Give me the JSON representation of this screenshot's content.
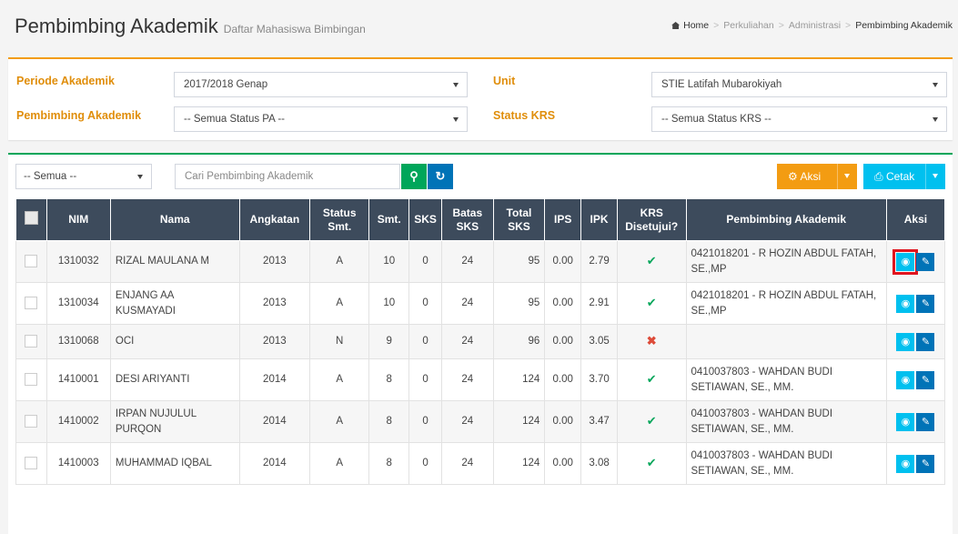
{
  "page": {
    "title": "Pembimbing Akademik",
    "subtitle": "Daftar Mahasiswa Bimbingan"
  },
  "breadcrumb": [
    "Home",
    "Perkuliahan",
    "Administrasi",
    "Pembimbing Akademik"
  ],
  "filters": {
    "periode_label": "Periode Akademik",
    "periode_value": "2017/2018 Genap",
    "unit_label": "Unit",
    "unit_value": "STIE Latifah Mubarokiyah",
    "pa_label": "Pembimbing Akademik",
    "pa_value": "-- Semua Status PA --",
    "krs_label": "Status KRS",
    "krs_value": "-- Semua Status KRS --"
  },
  "toolbar": {
    "filter_value": "-- Semua --",
    "search_placeholder": "Cari Pembimbing Akademik",
    "aksi_label": "Aksi",
    "cetak_label": "Cetak"
  },
  "columns": [
    "NIM",
    "Nama",
    "Angkatan",
    "Status Smt.",
    "Smt.",
    "SKS",
    "Batas SKS",
    "Total SKS",
    "IPS",
    "IPK",
    "KRS Disetujui?",
    "Pembimbing Akademik",
    "Aksi"
  ],
  "rows": [
    {
      "nim": "1310032",
      "nama": "RIZAL MAULANA M",
      "angkatan": "2013",
      "status": "A",
      "smt": "10",
      "sks": "0",
      "batas": "24",
      "total": "95",
      "ips": "0.00",
      "ipk": "2.79",
      "krs": "yes",
      "pa": "0421018201 - R HOZIN ABDUL FATAH, SE.,MP"
    },
    {
      "nim": "1310034",
      "nama": "ENJANG AA KUSMAYADI",
      "angkatan": "2013",
      "status": "A",
      "smt": "10",
      "sks": "0",
      "batas": "24",
      "total": "95",
      "ips": "0.00",
      "ipk": "2.91",
      "krs": "yes",
      "pa": "0421018201 - R HOZIN ABDUL FATAH, SE.,MP"
    },
    {
      "nim": "1310068",
      "nama": "OCI",
      "angkatan": "2013",
      "status": "N",
      "smt": "9",
      "sks": "0",
      "batas": "24",
      "total": "96",
      "ips": "0.00",
      "ipk": "3.05",
      "krs": "no",
      "pa": ""
    },
    {
      "nim": "1410001",
      "nama": "DESI ARIYANTI",
      "angkatan": "2014",
      "status": "A",
      "smt": "8",
      "sks": "0",
      "batas": "24",
      "total": "124",
      "ips": "0.00",
      "ipk": "3.70",
      "krs": "yes",
      "pa": "0410037803 - WAHDAN BUDI SETIAWAN, SE., MM."
    },
    {
      "nim": "1410002",
      "nama": "IRPAN NUJULUL PURQON",
      "angkatan": "2014",
      "status": "A",
      "smt": "8",
      "sks": "0",
      "batas": "24",
      "total": "124",
      "ips": "0.00",
      "ipk": "3.47",
      "krs": "yes",
      "pa": "0410037803 - WAHDAN BUDI SETIAWAN, SE., MM."
    },
    {
      "nim": "1410003",
      "nama": "MUHAMMAD IQBAL",
      "angkatan": "2014",
      "status": "A",
      "smt": "8",
      "sks": "0",
      "batas": "24",
      "total": "124",
      "ips": "0.00",
      "ipk": "3.08",
      "krs": "yes",
      "pa": "0410037803 - WAHDAN BUDI SETIAWAN, SE., MM."
    }
  ],
  "icons": {
    "ok": "✔",
    "no": "✖",
    "view": "◉",
    "edit": "✎"
  },
  "colors": {
    "orange": "#f39c12",
    "green": "#00a65a",
    "blue": "#0073b7",
    "aqua": "#00c0ef",
    "header": "#3d4b5c",
    "highlight": "#e0141e"
  }
}
